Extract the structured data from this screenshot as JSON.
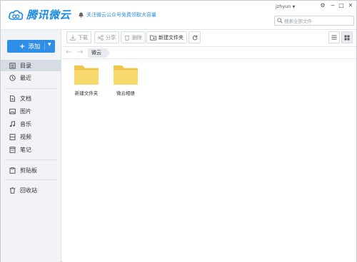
{
  "app": {
    "title": "腾讯微云"
  },
  "header": {
    "notice": "关注微云公众号免费领取大容量",
    "username": "jzhyun",
    "search_placeholder": "搜索全部文件"
  },
  "sidebar": {
    "add_label": "添加",
    "items": [
      {
        "label": "目录"
      },
      {
        "label": "最近"
      },
      {
        "label": "文档"
      },
      {
        "label": "图片"
      },
      {
        "label": "音乐"
      },
      {
        "label": "视频"
      },
      {
        "label": "笔记"
      },
      {
        "label": "剪贴板"
      },
      {
        "label": "回收站"
      }
    ]
  },
  "toolbar": {
    "download": "下载",
    "share": "分享",
    "delete": "删除",
    "new_folder": "新建文件夹"
  },
  "breadcrumb": {
    "current": "微云"
  },
  "files": [
    {
      "name": "新建文件夹"
    },
    {
      "name": "微云相册"
    }
  ],
  "colors": {
    "accent": "#2f8ee6",
    "folder": "#f7d56a",
    "sidebar_bg": "#f1f3f6"
  }
}
